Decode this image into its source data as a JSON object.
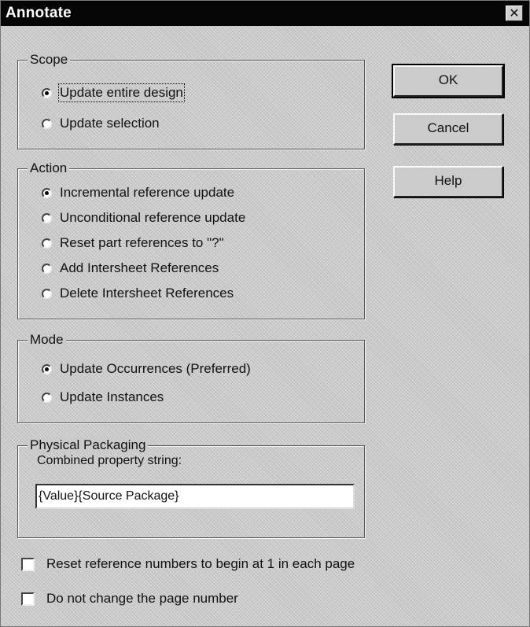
{
  "window": {
    "title": "Annotate",
    "close_glyph": "✕"
  },
  "scope": {
    "label": "Scope",
    "options": [
      {
        "label": "Update entire design",
        "selected": true
      },
      {
        "label": "Update selection",
        "selected": false
      }
    ]
  },
  "action": {
    "label": "Action",
    "options": [
      {
        "label": "Incremental reference update",
        "selected": true
      },
      {
        "label": "Unconditional reference update",
        "selected": false
      },
      {
        "label": "Reset part references to \"?\"",
        "selected": false
      },
      {
        "label": "Add Intersheet References",
        "selected": false
      },
      {
        "label": "Delete Intersheet References",
        "selected": false
      }
    ]
  },
  "mode": {
    "label": "Mode",
    "options": [
      {
        "label": "Update Occurrences (Preferred)",
        "selected": true
      },
      {
        "label": "Update Instances",
        "selected": false
      }
    ]
  },
  "packaging": {
    "label": "Physical Packaging",
    "field_label": "Combined property string:",
    "field_value": "{Value}{Source Package}"
  },
  "checkboxes": [
    {
      "label": "Reset reference numbers to begin at 1 in each page",
      "checked": false
    },
    {
      "label": "Do not change the page number",
      "checked": false
    }
  ],
  "buttons": {
    "ok": "OK",
    "cancel": "Cancel",
    "help": "Help"
  }
}
